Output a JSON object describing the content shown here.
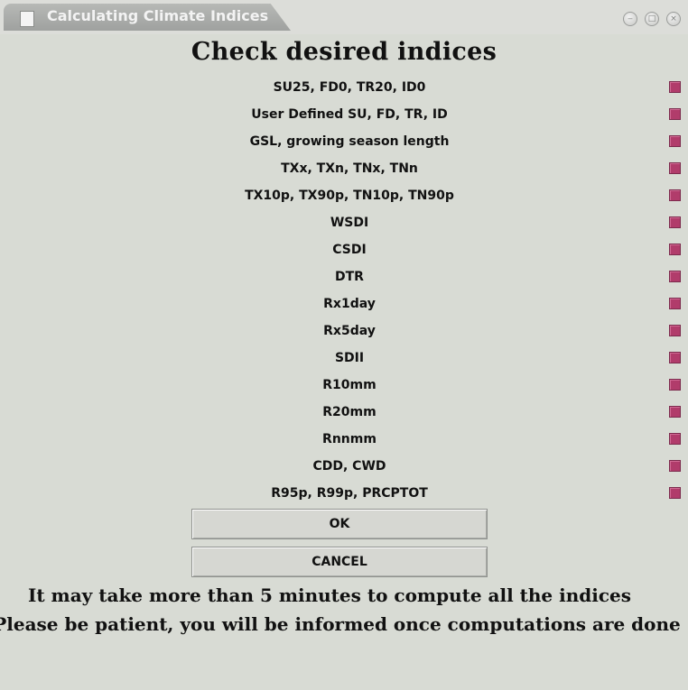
{
  "window": {
    "title": "Calculating Climate Indices",
    "controls": {
      "minimize": "‒",
      "maximize": "□",
      "close": "×"
    }
  },
  "heading": "Check desired indices",
  "indices": [
    {
      "label": "SU25, FD0, TR20, ID0",
      "checked": true
    },
    {
      "label": "User Defined SU, FD, TR, ID",
      "checked": true
    },
    {
      "label": "GSL, growing season length",
      "checked": true
    },
    {
      "label": "TXx, TXn, TNx, TNn",
      "checked": true
    },
    {
      "label": "TX10p, TX90p, TN10p, TN90p",
      "checked": true
    },
    {
      "label": "WSDI",
      "checked": true
    },
    {
      "label": "CSDI",
      "checked": true
    },
    {
      "label": "DTR",
      "checked": true
    },
    {
      "label": "Rx1day",
      "checked": true
    },
    {
      "label": "Rx5day",
      "checked": true
    },
    {
      "label": "SDII",
      "checked": true
    },
    {
      "label": "R10mm",
      "checked": true
    },
    {
      "label": "R20mm",
      "checked": true
    },
    {
      "label": "Rnnmm",
      "checked": true
    },
    {
      "label": "CDD, CWD",
      "checked": true
    },
    {
      "label": "R95p, R99p, PRCPTOT",
      "checked": true
    }
  ],
  "buttons": {
    "ok": "OK",
    "cancel": "CANCEL"
  },
  "messages": {
    "line1": "It may take more than 5 minutes to compute all the indices",
    "line2": "Please be patient, you will be informed once computations are done"
  },
  "colors": {
    "checkbox_checked": "#b13c6b",
    "background": "#d8dbd4"
  }
}
